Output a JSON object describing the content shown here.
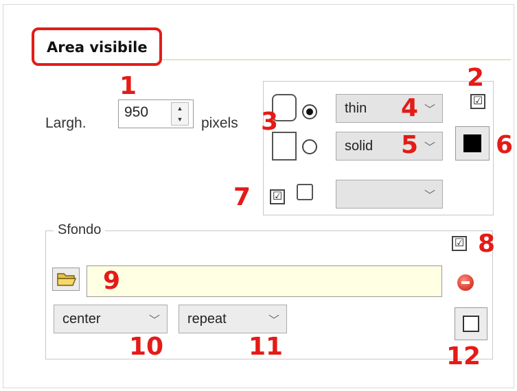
{
  "section": {
    "title": "Area visibile"
  },
  "width_field": {
    "label": "Largh.",
    "value": "950",
    "unit": "pixels"
  },
  "border": {
    "width_options_selected": "thin",
    "style_options_selected": "solid",
    "third_select_value": "",
    "show_border_checked": true,
    "color": "#000000"
  },
  "background": {
    "legend": "Sfondo",
    "enabled_checked": true,
    "image_path": "",
    "position_selected": "center",
    "repeat_selected": "repeat",
    "input_bg": "#ffffe4"
  },
  "checkbox_mark": "☑",
  "callouts": [
    "1",
    "2",
    "3",
    "4",
    "5",
    "6",
    "7",
    "8",
    "9",
    "10",
    "11",
    "12"
  ],
  "accent_color": "#e41b17"
}
